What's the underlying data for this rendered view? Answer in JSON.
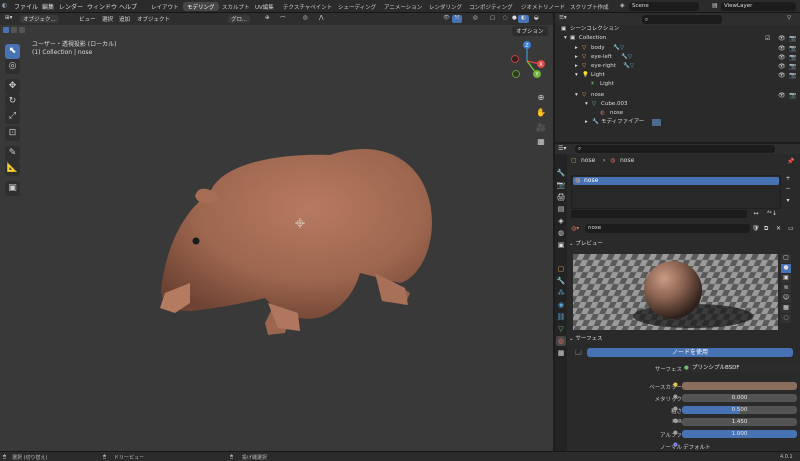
{
  "topbar": {
    "menus": [
      "ファイル",
      "編集",
      "レンダー",
      "ウィンドウ",
      "ヘルプ"
    ],
    "workspaces": [
      "レイアウト",
      "モデリング",
      "スカルプト",
      "UV編集",
      "テクスチャペイント",
      "シェーディング",
      "アニメーション",
      "レンダリング",
      "コンポジティング",
      "ジオメトリノード",
      "スクリプト作成"
    ],
    "active_workspace": "モデリング",
    "scene": "Scene",
    "view_layer": "ViewLayer"
  },
  "viewport": {
    "header_items": [
      "オブジェク...",
      "ビュー",
      "選択",
      "追加",
      "オブジェクト"
    ],
    "transform": "グロ...",
    "options": "オプション",
    "overlay_title": "ユーザー・透視投影 (ローカル)",
    "overlay_sub": "(1) Collection | nose",
    "axes": {
      "x": "X",
      "y": "Y",
      "z": "Z"
    }
  },
  "outliner": {
    "title": "シーンコレクション",
    "collection": "Collection",
    "items": [
      "body",
      "eye-left",
      "eye-right",
      "Light",
      "Light",
      "nose",
      "Cube.003",
      "nose",
      "モディファイアー"
    ]
  },
  "properties": {
    "breadcrumb": [
      "nose",
      "nose"
    ],
    "slot": "nose",
    "material_name": "nose",
    "preview_label": "プレビュー",
    "surface_label": "サーフェス",
    "use_nodes_label": "ノードを使用",
    "surface_field_label": "サーフェス",
    "surface_value": "プリンシプルBSDF",
    "rows": [
      {
        "label": "ベースカラー",
        "value": "",
        "fraction": 0
      },
      {
        "label": "メタリック",
        "value": "0.000",
        "fraction": 0
      },
      {
        "label": "粗さ",
        "value": "0.500",
        "fraction": 0.5
      },
      {
        "label": "IOR",
        "value": "1.450",
        "fraction": 0
      },
      {
        "label": "アルファ",
        "value": "1.000",
        "fraction": 1
      }
    ],
    "normal_label": "ノーマル",
    "normal_value": "デフォルト"
  },
  "status": {
    "select": "選択 (切り替え)",
    "drag": "ドリーピュー",
    "menu": "投げ縄選択",
    "version": "4.0.1"
  },
  "colors": {
    "accent": "#4772b3",
    "active_tab": "#474747",
    "model": "#a36b55",
    "base_color": "#8a6f5e"
  }
}
